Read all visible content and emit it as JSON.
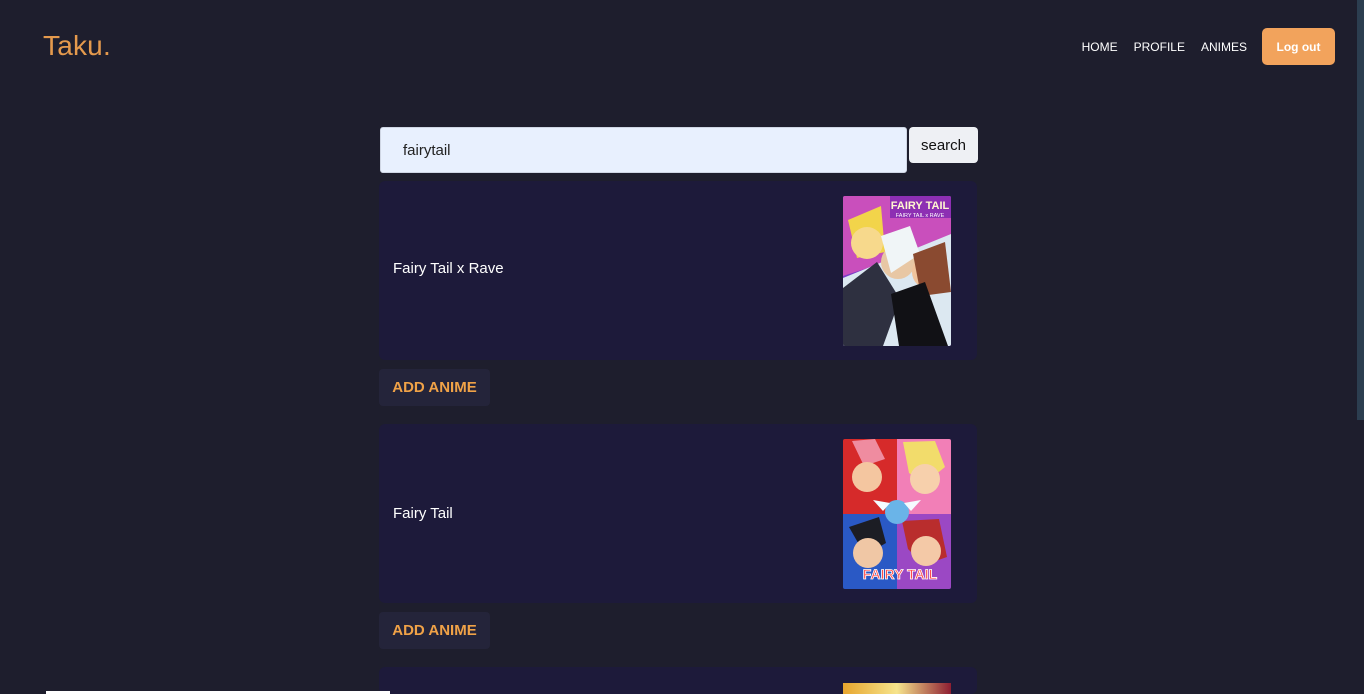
{
  "app": {
    "brand": "Taku.",
    "nav": {
      "home": "HOME",
      "profile": "PROFILE",
      "animes": "ANIMES",
      "logout": "Log out"
    }
  },
  "search": {
    "value": "fairytail",
    "button": "search"
  },
  "results": [
    {
      "title": "Fairy Tail x Rave",
      "action": "ADD ANIME",
      "poster_text": "FAIRY TAIL",
      "poster_subtitle": "FAIRY TAIL x RAVE"
    },
    {
      "title": "Fairy Tail",
      "action": "ADD ANIME",
      "poster_text": "FAIRY TAIL"
    }
  ],
  "colors": {
    "background": "#1e1e2d",
    "accent": "#e59a4d",
    "card": "#1d1a3a",
    "button_text": "#f0a247"
  }
}
